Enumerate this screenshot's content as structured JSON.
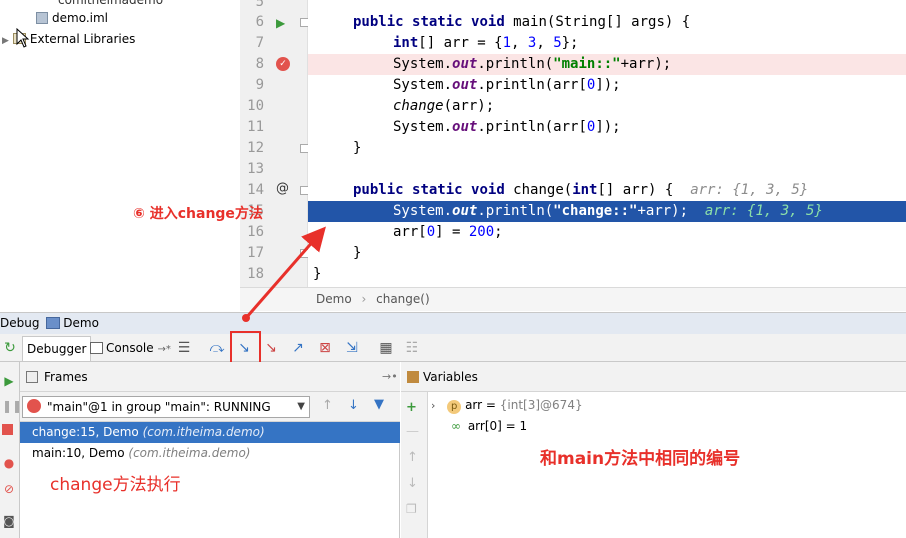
{
  "project_tree": {
    "partial_item": "comitheimademo",
    "file_item": "demo.iml",
    "libraries_item": "External Libraries"
  },
  "editor": {
    "lines": [
      {
        "n": "5"
      },
      {
        "n": "6"
      },
      {
        "n": "7"
      },
      {
        "n": "8"
      },
      {
        "n": "9"
      },
      {
        "n": "10"
      },
      {
        "n": "11"
      },
      {
        "n": "12"
      },
      {
        "n": "13"
      },
      {
        "n": "14"
      },
      {
        "n": "15"
      },
      {
        "n": "16"
      },
      {
        "n": "17"
      },
      {
        "n": "18"
      }
    ],
    "code": {
      "l6_kw1": "public",
      "l6_kw2": "static",
      "l6_kw3": "void",
      "l6_rest": " main(String[] args) {",
      "l7_kw": "int",
      "l7_mid": "[] arr = {",
      "l7_n1": "1",
      "l7_c1": ", ",
      "l7_n2": "3",
      "l7_c2": ", ",
      "l7_n3": "5",
      "l7_end": "};",
      "l8_a": "System.",
      "l8_out": "out",
      "l8_b": ".println(",
      "l8_str": "\"main::\"",
      "l8_c": "+arr);",
      "l9_a": "System.",
      "l9_out": "out",
      "l9_b": ".println(arr[",
      "l9_n": "0",
      "l9_c": "]);",
      "l10_call": "change",
      "l10_rest": "(arr);",
      "l11_a": "System.",
      "l11_out": "out",
      "l11_b": ".println(arr[",
      "l11_n": "0",
      "l11_c": "]);",
      "l12": "}",
      "l14_kw1": "public",
      "l14_kw2": "static",
      "l14_kw3": "void",
      "l14_mid": " change(",
      "l14_kw4": "int",
      "l14_rest": "[] arr) {",
      "l14_hint": "arr: {1, 3, 5}",
      "l15_a": "System.",
      "l15_out": "out",
      "l15_b": ".println(",
      "l15_str": "\"change::\"",
      "l15_c": "+arr);",
      "l15_hint": "arr: {1, 3, 5}",
      "l16_a": "arr[",
      "l16_n1": "0",
      "l16_b": "] = ",
      "l16_n2": "200",
      "l16_c": ";",
      "l17": "}",
      "l18": "}"
    },
    "gutter_marks": {
      "run": "▶",
      "breakpoint": "✓",
      "override": "@"
    }
  },
  "breadcrumb": {
    "items": [
      "Demo",
      "change()"
    ],
    "sep": "›"
  },
  "debug_window": {
    "title_prefix": "Debug",
    "config_name": "Demo",
    "tabs": {
      "debugger": "Debugger",
      "console": "Console",
      "console_suffix": "→*"
    },
    "frames_title": "Frames",
    "thread_value": "\"main\"@1 in group \"main\": RUNNING",
    "frames": [
      {
        "method": "change:15, Demo",
        "pkg": "(com.itheima.demo)"
      },
      {
        "method": "main:10, Demo",
        "pkg": "(com.itheima.demo)"
      }
    ],
    "variables_title": "Variables",
    "variables": {
      "param_badge": "p",
      "arr_name": "arr",
      "arr_eq": " = ",
      "arr_value": "{int[3]@674}",
      "elem_label": "arr[0] = 1"
    }
  },
  "annotations": {
    "step_into": "⑥ 进入change方法",
    "change_exec": "change方法执行",
    "same_id": "和main方法中相同的编号",
    "accent": "#e8302a"
  }
}
